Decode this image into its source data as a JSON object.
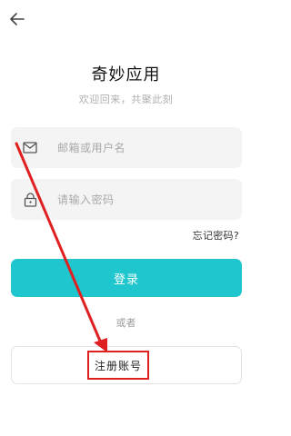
{
  "header": {
    "back_icon": "arrow-left-icon"
  },
  "app": {
    "title": "奇妙应用",
    "subtitle": "欢迎回来，共聚此刻"
  },
  "form": {
    "username": {
      "icon": "mail-icon",
      "placeholder": "邮箱或用户名"
    },
    "password": {
      "icon": "lock-icon",
      "placeholder": "请输入密码"
    },
    "forgot_label": "忘记密码?",
    "login_label": "登录",
    "or_label": "或者",
    "register_label": "注册账号"
  },
  "colors": {
    "accent": "#1fc6cd",
    "annotation": "#e02020"
  }
}
